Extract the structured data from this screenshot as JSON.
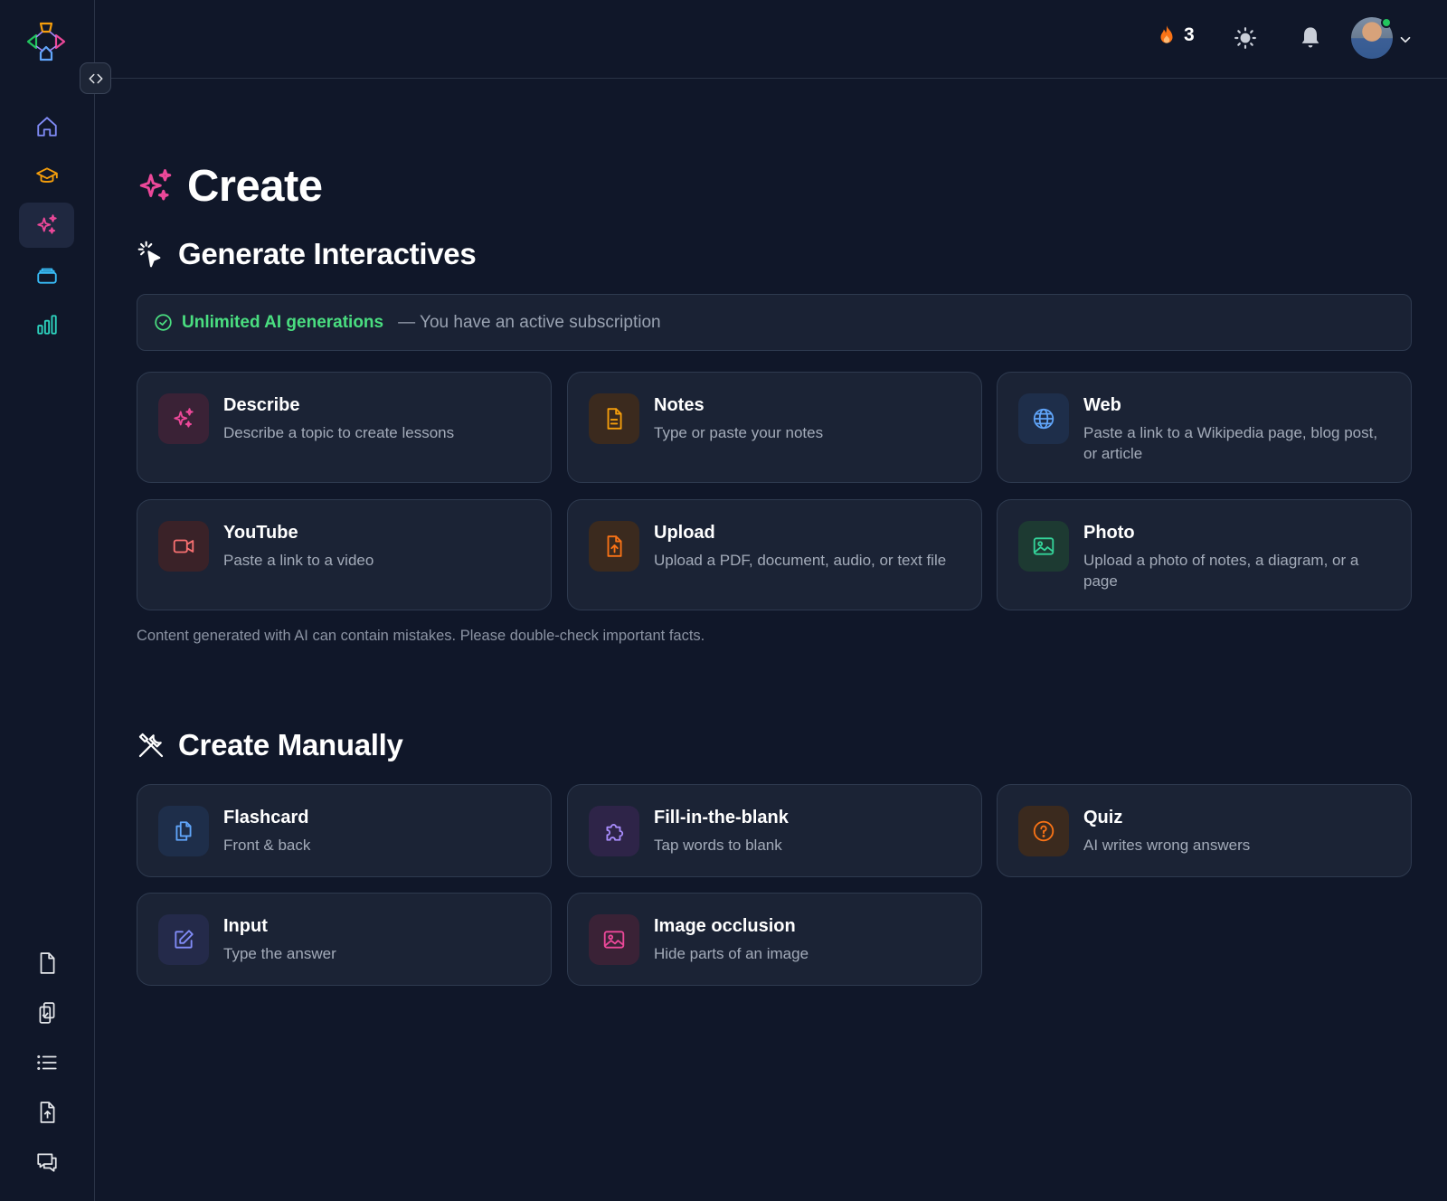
{
  "topbar": {
    "streak_count": "3"
  },
  "page": {
    "title": "Create"
  },
  "generate": {
    "title": "Generate Interactives",
    "banner_strong": "Unlimited AI generations",
    "banner_rest": "— You have an active subscription",
    "cards": [
      {
        "title": "Describe",
        "description": "Describe a topic to create lessons",
        "icon": "sparkles-icon"
      },
      {
        "title": "Notes",
        "description": "Type or paste your notes",
        "icon": "document-icon"
      },
      {
        "title": "Web",
        "description": "Paste a link to a Wikipedia page, blog post, or article",
        "icon": "globe-icon"
      },
      {
        "title": "YouTube",
        "description": "Paste a link to a video",
        "icon": "video-icon"
      },
      {
        "title": "Upload",
        "description": "Upload a PDF, document, audio, or text file",
        "icon": "file-upload-icon"
      },
      {
        "title": "Photo",
        "description": "Upload a photo of notes, a diagram, or a page",
        "icon": "image-icon"
      }
    ],
    "disclaimer": "Content generated with AI can contain mistakes. Please double-check important facts."
  },
  "manual": {
    "title": "Create Manually",
    "cards": [
      {
        "title": "Flashcard",
        "description": "Front & back",
        "icon": "copy-icon"
      },
      {
        "title": "Fill-in-the-blank",
        "description": "Tap words to blank",
        "icon": "puzzle-icon"
      },
      {
        "title": "Quiz",
        "description": "AI writes wrong answers",
        "icon": "question-circle-icon"
      },
      {
        "title": "Input",
        "description": "Type the answer",
        "icon": "pencil-icon"
      },
      {
        "title": "Image occlusion",
        "description": "Hide parts of an image",
        "icon": "image-icon"
      }
    ]
  },
  "colors": {
    "background": "#101729",
    "card": "#1b2335",
    "accent_green": "#4ade80",
    "accent_pink": "#ec4899"
  }
}
